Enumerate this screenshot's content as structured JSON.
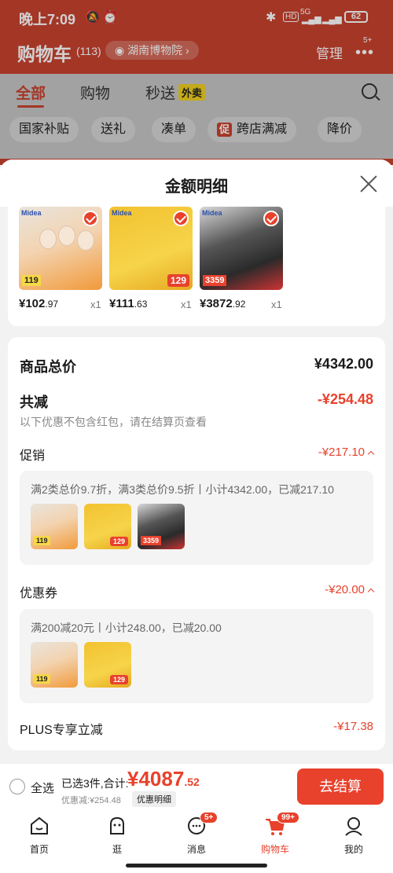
{
  "status": {
    "time": "晚上7:09",
    "network": "5G",
    "battery": "62"
  },
  "header": {
    "title": "购物车",
    "count": "(113)",
    "location": "湖南博物院",
    "manage": "管理",
    "more_badge": "5+"
  },
  "tabs": [
    {
      "label": "全部"
    },
    {
      "label": "购物"
    },
    {
      "label": "秒送"
    }
  ],
  "tab_badge": "外卖",
  "filters": [
    {
      "label": "国家补贴"
    },
    {
      "label": "送礼"
    },
    {
      "label": "凑单"
    },
    {
      "label": "跨店满减"
    },
    {
      "label": "降价"
    }
  ],
  "filter_promo_tag": "促",
  "sheet": {
    "title": "金额明细",
    "products": [
      {
        "name": "Midea egg steamer",
        "brand": "Midea",
        "badge_price": "119",
        "price_int": "¥102",
        "price_dec": ".97",
        "qty": "x1"
      },
      {
        "name": "Midea rice cooker",
        "brand": "Midea",
        "badge_price": "129",
        "price_int": "¥111",
        "price_dec": ".63",
        "qty": "x1"
      },
      {
        "name": "Midea range hood",
        "brand": "Midea",
        "badge_price": "3359",
        "price_int": "¥3872",
        "price_dec": ".92",
        "qty": "x1"
      }
    ],
    "total_label": "商品总价",
    "total_value": "¥4342.00",
    "reduce_label": "共减",
    "reduce_value": "-¥254.48",
    "note": "以下优惠不包含红包，请在结算页查看",
    "promo_label": "促销",
    "promo_value": "-¥217.10",
    "promo_detail": "满2类总价9.7折，满3类总价9.5折丨小计4342.00，已减217.10",
    "coupon_label": "优惠券",
    "coupon_value": "-¥20.00",
    "coupon_detail": "满200减20元丨小计248.00，已减20.00",
    "plus_label": "PLUS专享立减",
    "plus_value": "-¥17.38"
  },
  "checkout": {
    "select_all": "全选",
    "selected": "已选3件,合计:",
    "total_int": "¥4087",
    "total_dec": ".52",
    "discount": "优惠减:¥254.48",
    "detail_btn": "优惠明细",
    "button": "去结算"
  },
  "nav": [
    {
      "label": "首页",
      "icon": "home-icon"
    },
    {
      "label": "逛",
      "icon": "face-icon"
    },
    {
      "label": "消息",
      "icon": "chat-icon",
      "badge": "5+"
    },
    {
      "label": "购物车",
      "icon": "cart-icon",
      "badge": "99+",
      "active": true
    },
    {
      "label": "我的",
      "icon": "profile-icon"
    }
  ],
  "colors": {
    "brand": "#c8432f",
    "accent": "#e8412c"
  }
}
